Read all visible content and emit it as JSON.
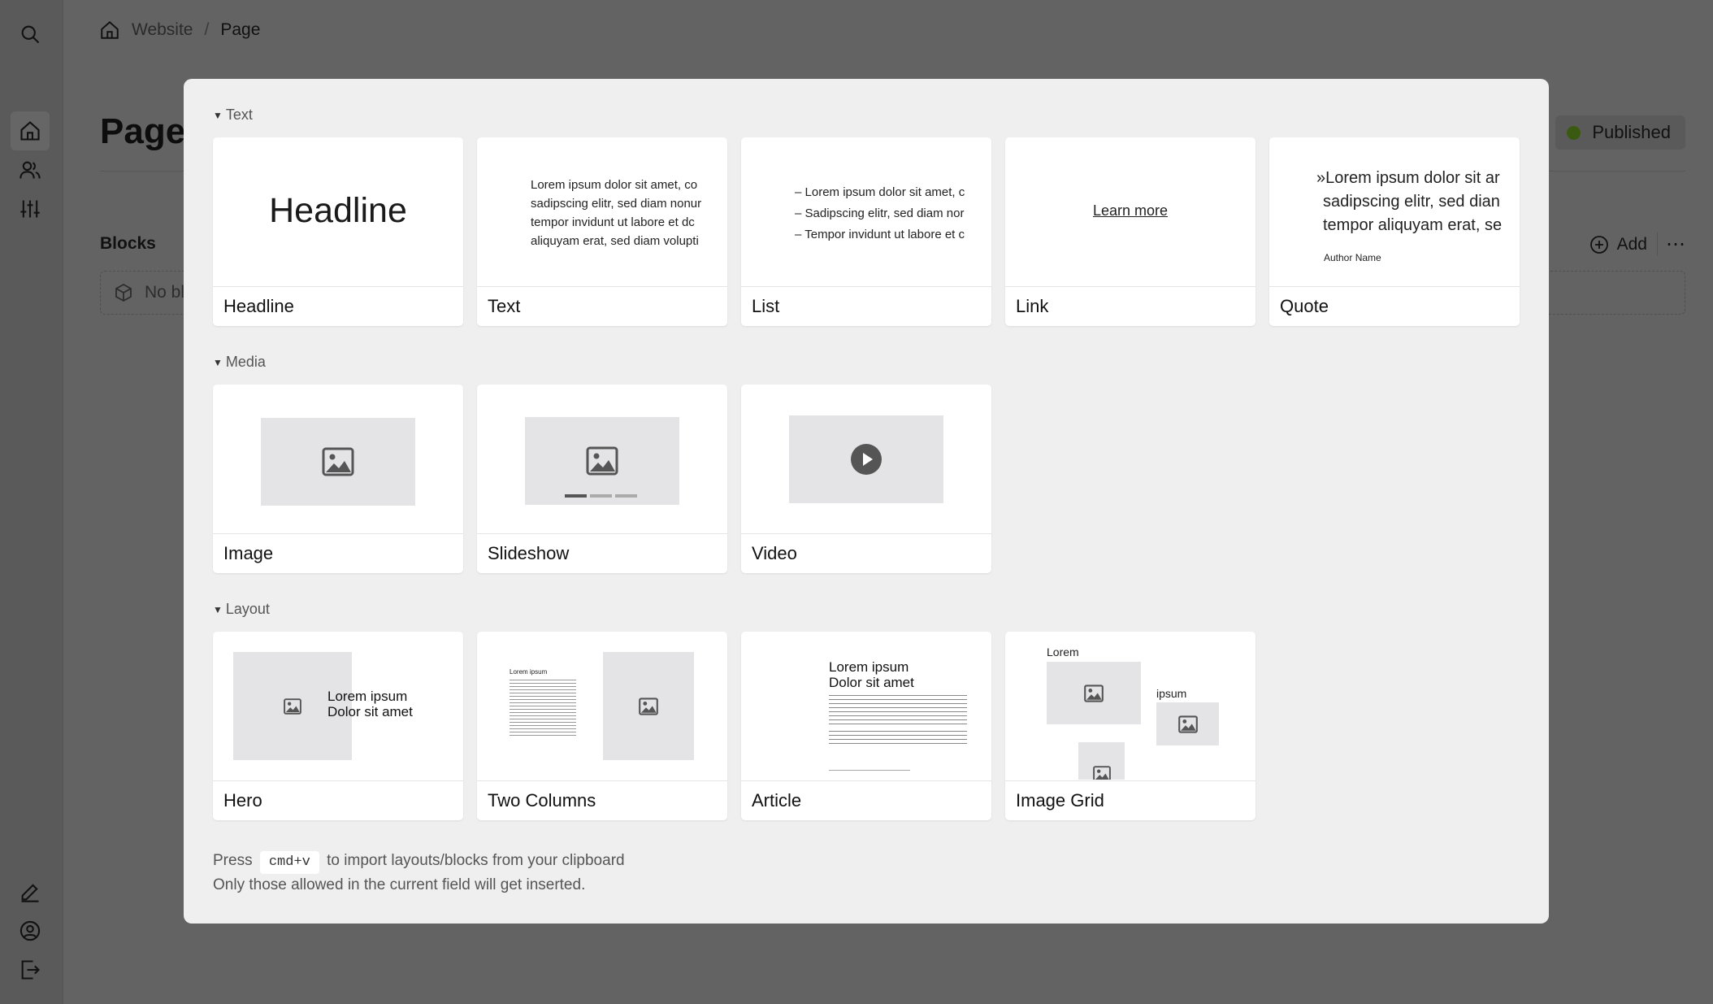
{
  "breadcrumb": {
    "home": "Website",
    "separator": "/",
    "current": "Page"
  },
  "page": {
    "title": "Page",
    "status": "Published"
  },
  "blocks": {
    "label": "Blocks",
    "empty_text": "No bl",
    "add_label": "Add",
    "more": "⋯"
  },
  "sidebar": {
    "top": [
      "search-icon"
    ],
    "nav": [
      "home-icon",
      "users-icon",
      "settings-sliders-icon"
    ],
    "bottom": [
      "edit-icon",
      "account-icon",
      "logout-icon"
    ]
  },
  "modal": {
    "sections": {
      "text": {
        "title": "Text",
        "cards": {
          "headline": {
            "label": "Headline",
            "preview": "Headline"
          },
          "text": {
            "label": "Text",
            "lines": [
              "Lorem ipsum dolor sit amet, co",
              "sadipscing elitr, sed diam nonur",
              "tempor invidunt ut labore et dc",
              "aliquyam erat, sed diam volupti"
            ]
          },
          "list": {
            "label": "List",
            "lines": [
              "– Lorem ipsum dolor sit amet, c",
              "– Sadipscing elitr, sed diam nor",
              "– Tempor invidunt ut labore et c"
            ]
          },
          "link": {
            "label": "Link",
            "preview": "Learn more"
          },
          "quote": {
            "label": "Quote",
            "lines": [
              "»Lorem ipsum dolor sit ar",
              "sadipscing elitr, sed dian",
              "tempor aliquyam erat, se"
            ],
            "author": "Author Name"
          }
        }
      },
      "media": {
        "title": "Media",
        "cards": {
          "image": {
            "label": "Image"
          },
          "slideshow": {
            "label": "Slideshow"
          },
          "video": {
            "label": "Video"
          }
        }
      },
      "layout": {
        "title": "Layout",
        "cards": {
          "hero": {
            "label": "Hero",
            "line1": "Lorem ipsum",
            "line2": "Dolor sit amet"
          },
          "two_columns": {
            "label": "Two Columns",
            "heading": "Lorem ipsum"
          },
          "article": {
            "label": "Article",
            "line1": "Lorem ipsum",
            "line2": "Dolor sit amet"
          },
          "image_grid": {
            "label": "Image Grid",
            "caption1": "Lorem",
            "caption2": "ipsum"
          }
        }
      }
    },
    "footer": {
      "press": "Press",
      "shortcut": "cmd+v",
      "rest": "to import layouts/blocks from your clipboard",
      "line2": "Only those allowed in the current field will get inserted."
    }
  }
}
